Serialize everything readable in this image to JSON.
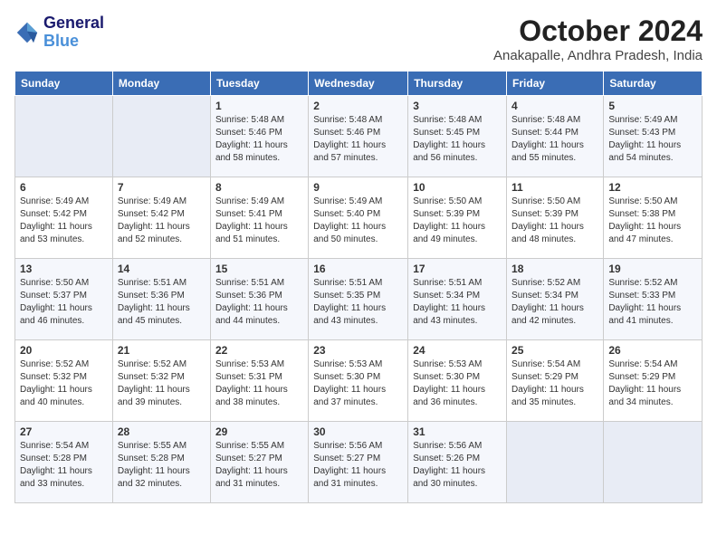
{
  "logo": {
    "line1": "General",
    "line2": "Blue"
  },
  "title": "October 2024",
  "location": "Anakapalle, Andhra Pradesh, India",
  "days_of_week": [
    "Sunday",
    "Monday",
    "Tuesday",
    "Wednesday",
    "Thursday",
    "Friday",
    "Saturday"
  ],
  "weeks": [
    [
      {
        "num": "",
        "sunrise": "",
        "sunset": "",
        "daylight": ""
      },
      {
        "num": "",
        "sunrise": "",
        "sunset": "",
        "daylight": ""
      },
      {
        "num": "1",
        "sunrise": "Sunrise: 5:48 AM",
        "sunset": "Sunset: 5:46 PM",
        "daylight": "Daylight: 11 hours and 58 minutes."
      },
      {
        "num": "2",
        "sunrise": "Sunrise: 5:48 AM",
        "sunset": "Sunset: 5:46 PM",
        "daylight": "Daylight: 11 hours and 57 minutes."
      },
      {
        "num": "3",
        "sunrise": "Sunrise: 5:48 AM",
        "sunset": "Sunset: 5:45 PM",
        "daylight": "Daylight: 11 hours and 56 minutes."
      },
      {
        "num": "4",
        "sunrise": "Sunrise: 5:48 AM",
        "sunset": "Sunset: 5:44 PM",
        "daylight": "Daylight: 11 hours and 55 minutes."
      },
      {
        "num": "5",
        "sunrise": "Sunrise: 5:49 AM",
        "sunset": "Sunset: 5:43 PM",
        "daylight": "Daylight: 11 hours and 54 minutes."
      }
    ],
    [
      {
        "num": "6",
        "sunrise": "Sunrise: 5:49 AM",
        "sunset": "Sunset: 5:42 PM",
        "daylight": "Daylight: 11 hours and 53 minutes."
      },
      {
        "num": "7",
        "sunrise": "Sunrise: 5:49 AM",
        "sunset": "Sunset: 5:42 PM",
        "daylight": "Daylight: 11 hours and 52 minutes."
      },
      {
        "num": "8",
        "sunrise": "Sunrise: 5:49 AM",
        "sunset": "Sunset: 5:41 PM",
        "daylight": "Daylight: 11 hours and 51 minutes."
      },
      {
        "num": "9",
        "sunrise": "Sunrise: 5:49 AM",
        "sunset": "Sunset: 5:40 PM",
        "daylight": "Daylight: 11 hours and 50 minutes."
      },
      {
        "num": "10",
        "sunrise": "Sunrise: 5:50 AM",
        "sunset": "Sunset: 5:39 PM",
        "daylight": "Daylight: 11 hours and 49 minutes."
      },
      {
        "num": "11",
        "sunrise": "Sunrise: 5:50 AM",
        "sunset": "Sunset: 5:39 PM",
        "daylight": "Daylight: 11 hours and 48 minutes."
      },
      {
        "num": "12",
        "sunrise": "Sunrise: 5:50 AM",
        "sunset": "Sunset: 5:38 PM",
        "daylight": "Daylight: 11 hours and 47 minutes."
      }
    ],
    [
      {
        "num": "13",
        "sunrise": "Sunrise: 5:50 AM",
        "sunset": "Sunset: 5:37 PM",
        "daylight": "Daylight: 11 hours and 46 minutes."
      },
      {
        "num": "14",
        "sunrise": "Sunrise: 5:51 AM",
        "sunset": "Sunset: 5:36 PM",
        "daylight": "Daylight: 11 hours and 45 minutes."
      },
      {
        "num": "15",
        "sunrise": "Sunrise: 5:51 AM",
        "sunset": "Sunset: 5:36 PM",
        "daylight": "Daylight: 11 hours and 44 minutes."
      },
      {
        "num": "16",
        "sunrise": "Sunrise: 5:51 AM",
        "sunset": "Sunset: 5:35 PM",
        "daylight": "Daylight: 11 hours and 43 minutes."
      },
      {
        "num": "17",
        "sunrise": "Sunrise: 5:51 AM",
        "sunset": "Sunset: 5:34 PM",
        "daylight": "Daylight: 11 hours and 43 minutes."
      },
      {
        "num": "18",
        "sunrise": "Sunrise: 5:52 AM",
        "sunset": "Sunset: 5:34 PM",
        "daylight": "Daylight: 11 hours and 42 minutes."
      },
      {
        "num": "19",
        "sunrise": "Sunrise: 5:52 AM",
        "sunset": "Sunset: 5:33 PM",
        "daylight": "Daylight: 11 hours and 41 minutes."
      }
    ],
    [
      {
        "num": "20",
        "sunrise": "Sunrise: 5:52 AM",
        "sunset": "Sunset: 5:32 PM",
        "daylight": "Daylight: 11 hours and 40 minutes."
      },
      {
        "num": "21",
        "sunrise": "Sunrise: 5:52 AM",
        "sunset": "Sunset: 5:32 PM",
        "daylight": "Daylight: 11 hours and 39 minutes."
      },
      {
        "num": "22",
        "sunrise": "Sunrise: 5:53 AM",
        "sunset": "Sunset: 5:31 PM",
        "daylight": "Daylight: 11 hours and 38 minutes."
      },
      {
        "num": "23",
        "sunrise": "Sunrise: 5:53 AM",
        "sunset": "Sunset: 5:30 PM",
        "daylight": "Daylight: 11 hours and 37 minutes."
      },
      {
        "num": "24",
        "sunrise": "Sunrise: 5:53 AM",
        "sunset": "Sunset: 5:30 PM",
        "daylight": "Daylight: 11 hours and 36 minutes."
      },
      {
        "num": "25",
        "sunrise": "Sunrise: 5:54 AM",
        "sunset": "Sunset: 5:29 PM",
        "daylight": "Daylight: 11 hours and 35 minutes."
      },
      {
        "num": "26",
        "sunrise": "Sunrise: 5:54 AM",
        "sunset": "Sunset: 5:29 PM",
        "daylight": "Daylight: 11 hours and 34 minutes."
      }
    ],
    [
      {
        "num": "27",
        "sunrise": "Sunrise: 5:54 AM",
        "sunset": "Sunset: 5:28 PM",
        "daylight": "Daylight: 11 hours and 33 minutes."
      },
      {
        "num": "28",
        "sunrise": "Sunrise: 5:55 AM",
        "sunset": "Sunset: 5:28 PM",
        "daylight": "Daylight: 11 hours and 32 minutes."
      },
      {
        "num": "29",
        "sunrise": "Sunrise: 5:55 AM",
        "sunset": "Sunset: 5:27 PM",
        "daylight": "Daylight: 11 hours and 31 minutes."
      },
      {
        "num": "30",
        "sunrise": "Sunrise: 5:56 AM",
        "sunset": "Sunset: 5:27 PM",
        "daylight": "Daylight: 11 hours and 31 minutes."
      },
      {
        "num": "31",
        "sunrise": "Sunrise: 5:56 AM",
        "sunset": "Sunset: 5:26 PM",
        "daylight": "Daylight: 11 hours and 30 minutes."
      },
      {
        "num": "",
        "sunrise": "",
        "sunset": "",
        "daylight": ""
      },
      {
        "num": "",
        "sunrise": "",
        "sunset": "",
        "daylight": ""
      }
    ]
  ]
}
